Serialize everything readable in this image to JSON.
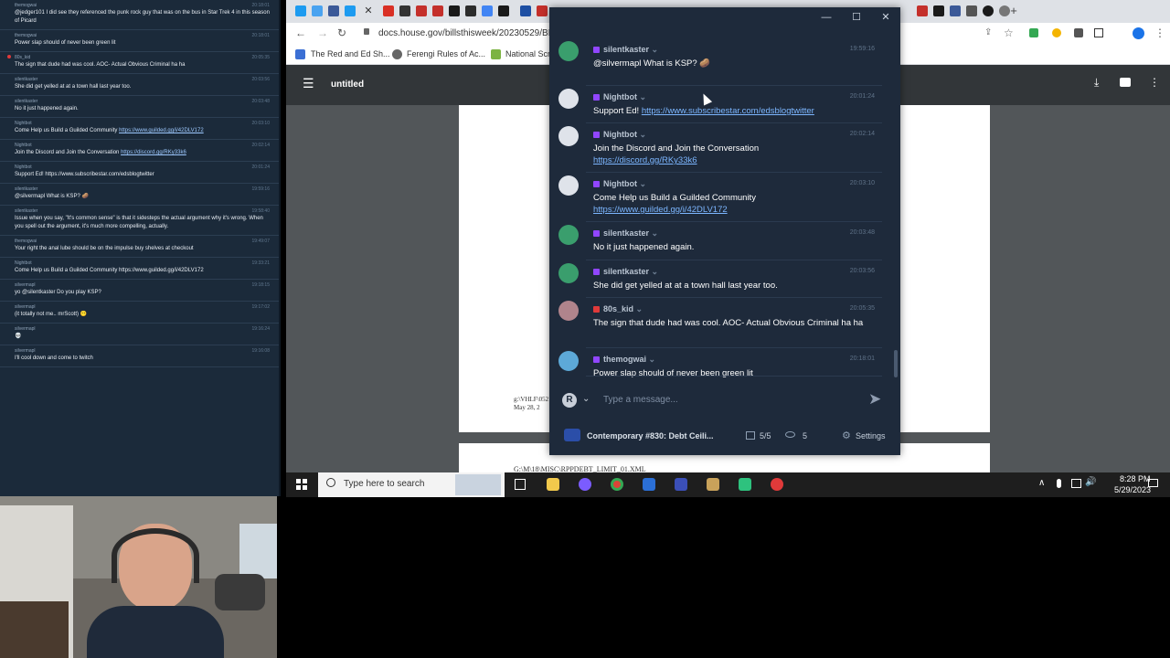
{
  "left_chat": [
    {
      "user": "themogwai",
      "time": "20:18:01",
      "text": "@jedger101 I did see they referenced the punk rock guy that was on the bus in Star Trek 4 in this season of Picard",
      "dot": ""
    },
    {
      "user": "themogwai",
      "time": "20:18:01",
      "text": "Power slap should of never been green lit",
      "dot": ""
    },
    {
      "user": "80s_kid",
      "time": "20:05:35",
      "text": "The sign that dude had was cool. AOC- Actual Obvious Criminal ha ha",
      "dot": "#e03a3a"
    },
    {
      "user": "silentkaster",
      "time": "20:03:56",
      "text": "She did get yelled at at a town hall last year too.",
      "dot": ""
    },
    {
      "user": "silentkaster",
      "time": "20:03:48",
      "text": "No it just happened again.",
      "dot": ""
    },
    {
      "user": "Nightbot",
      "time": "20:03:10",
      "text": "Come Help us Build a Guilded Community ",
      "link": "https://www.guilded.gg/i/42DLV172",
      "dot": ""
    },
    {
      "user": "Nightbot",
      "time": "20:02:14",
      "text": "Join the Discord and Join the Conversation ",
      "link": "https://discord.gg/RKy33k6",
      "dot": ""
    },
    {
      "user": "Nightbot",
      "time": "20:01:24",
      "text": "Support Ed! https://www.subscribestar.com/edsblogtwitter",
      "dot": ""
    },
    {
      "user": "silentkaster",
      "time": "19:59:16",
      "text": "@silvermapl What is KSP? 🥔",
      "dot": ""
    },
    {
      "user": "silentkaster",
      "time": "19:58:40",
      "text": "Issue when you say, \"It's common sense\" is that it sidesteps the actual argument why it's wrong. When you spell out the argument, it's much more compelling, actually.",
      "dot": ""
    },
    {
      "user": "themogwai",
      "time": "19:49:07",
      "text": "Your right the anal lube should be on the impulse buy shelves at checkout",
      "dot": ""
    },
    {
      "user": "Nightbot",
      "time": "19:33:21",
      "text": "Come Help us Build a Guilded Community https://www.guilded.gg/i/42DLV172",
      "dot": ""
    },
    {
      "user": "silvermapl",
      "time": "19:18:15",
      "text": "yo @silentkaster Do you play KSP?",
      "dot": ""
    },
    {
      "user": "silvermapl",
      "time": "19:17:02",
      "text": "(it totally not me.. mrScott) 😶",
      "dot": ""
    },
    {
      "user": "silvermapl",
      "time": "19:16:24",
      "text": "💀",
      "dot": ""
    },
    {
      "user": "silvermapl",
      "time": "19:16:08",
      "text": "I'll cool down and come to twitch",
      "dot": ""
    }
  ],
  "browser": {
    "url": "docs.house.gov/billsthisweek/20230529/BI",
    "bookmarks": [
      "The Red and Ed Sh...",
      "Ferengi Rules of Ac...",
      "National Scra"
    ],
    "pdf_title": "untitled",
    "pdf_text_1": "g:\\VHLF\\052",
    "pdf_text_2": "May 28, 2",
    "pdf_text_3": "G:\\M\\18\\MISC\\RPPDEBT_LIMIT_01.XML"
  },
  "taskbar": {
    "search_placeholder": "Type here to search",
    "time": "8:28 PM",
    "date": "5/29/2023"
  },
  "popup": {
    "messages": [
      {
        "user": "silentkaster",
        "time": "19:59:16",
        "text": "@silvermapl What is KSP? 🥔",
        "avatar": "#3a9e6d",
        "badge": "#9146ff"
      },
      {
        "user": "Nightbot",
        "time": "20:01:24",
        "text": "Support Ed! ",
        "link": "https://www.subscribestar.com/edsblogtwitter",
        "avatar": "#dfe3ea",
        "badge": "#9146ff"
      },
      {
        "user": "Nightbot",
        "time": "20:02:14",
        "text": "Join the Discord and Join the Conversation",
        "link": "https://discord.gg/RKy33k6",
        "avatar": "#dfe3ea",
        "badge": "#9146ff"
      },
      {
        "user": "Nightbot",
        "time": "20:03:10",
        "text": "Come Help us Build a Guilded Community",
        "link": "https://www.guilded.gg/i/42DLV172",
        "avatar": "#dfe3ea",
        "badge": "#9146ff"
      },
      {
        "user": "silentkaster",
        "time": "20:03:48",
        "text": "No it just happened again.",
        "avatar": "#3a9e6d",
        "badge": "#9146ff"
      },
      {
        "user": "silentkaster",
        "time": "20:03:56",
        "text": "She did get yelled at at a town hall last year too.",
        "avatar": "#3a9e6d",
        "badge": "#9146ff"
      },
      {
        "user": "80s_kid",
        "time": "20:05:35",
        "text": "The sign that dude had was cool. AOC- Actual Obvious Criminal ha ha",
        "avatar": "#b0848c",
        "badge": "#e03a3a"
      },
      {
        "user": "themogwai",
        "time": "20:18:01",
        "text": "Power slap should of never been green lit",
        "avatar": "#5da9d8",
        "badge": "#9146ff"
      }
    ],
    "input_placeholder": "Type a message...",
    "account_initial": "R",
    "stream_title": "Contemporary #830: Debt Ceili...",
    "platform_count": "5/5",
    "viewer_count": "5",
    "settings_label": "Settings"
  }
}
